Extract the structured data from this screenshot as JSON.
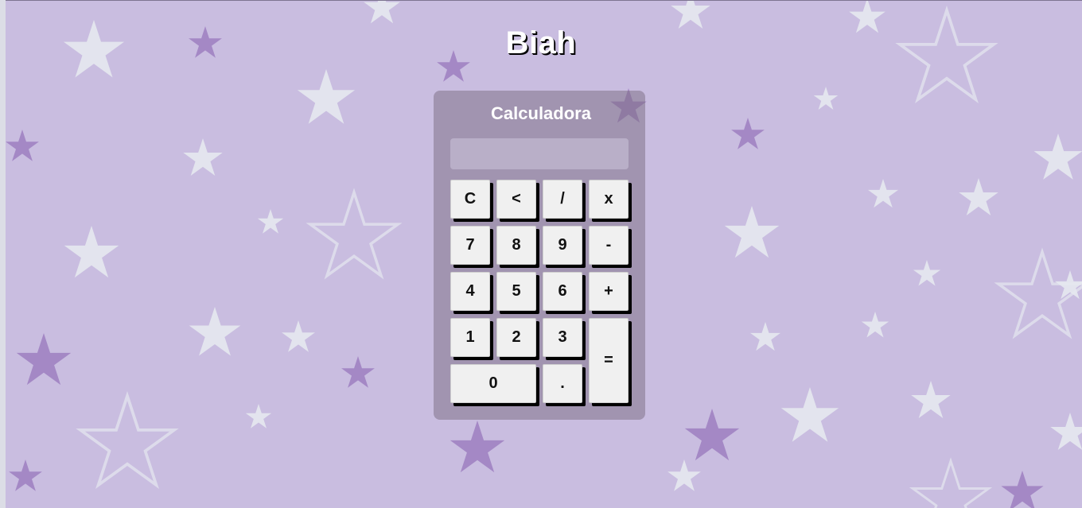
{
  "page": {
    "title": "Biah"
  },
  "calculator": {
    "title": "Calculadora",
    "display": {
      "value": "",
      "placeholder": ""
    },
    "buttons": {
      "clear": "C",
      "backspace": "<",
      "divide": "/",
      "multiply": "x",
      "seven": "7",
      "eight": "8",
      "nine": "9",
      "subtract": "-",
      "four": "4",
      "five": "5",
      "six": "6",
      "add": "+",
      "one": "1",
      "two": "2",
      "three": "3",
      "equals": "=",
      "zero": "0",
      "decimal": "."
    }
  },
  "colors": {
    "background": "#c9bde0",
    "star_light": "#e6e9f0",
    "star_dark": "#9d7fc0",
    "panel": "#7a6c80",
    "button": "#f0f0f0",
    "button_shadow": "#000000"
  }
}
